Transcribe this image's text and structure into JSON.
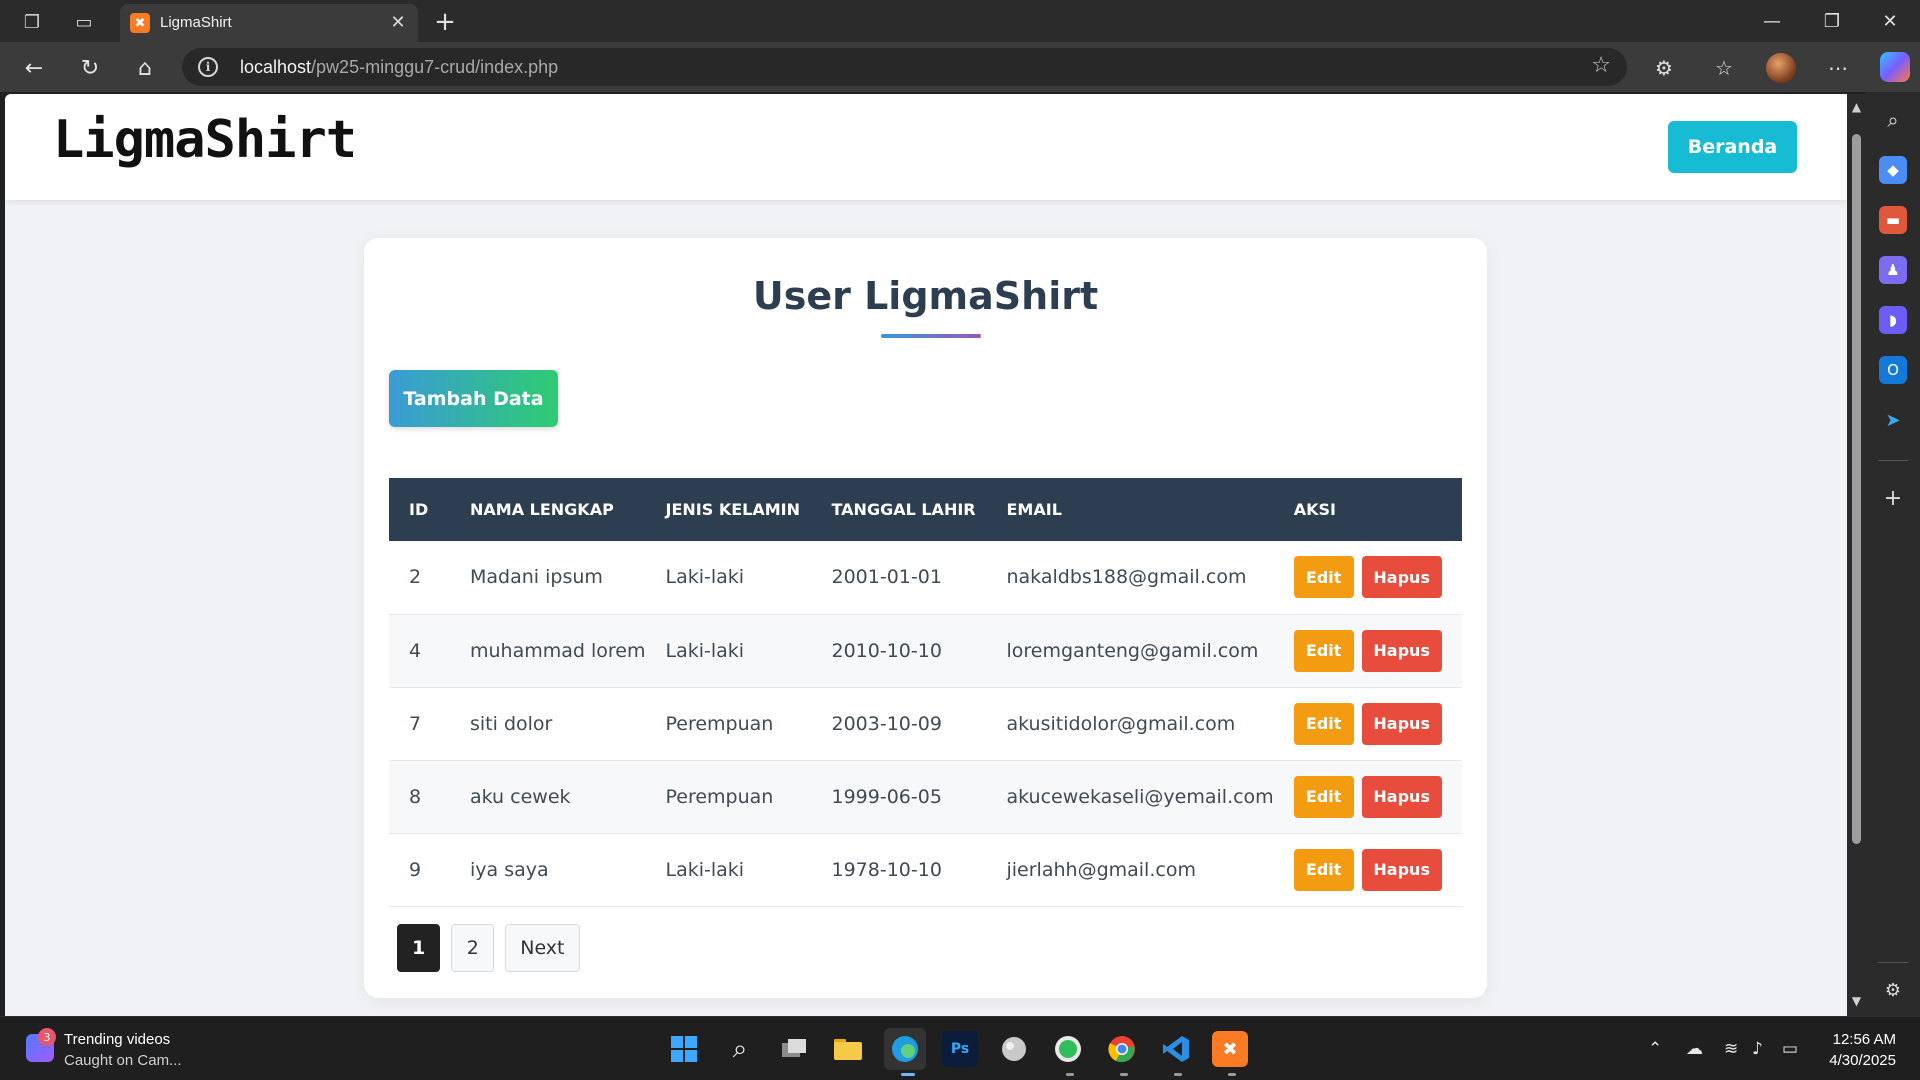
{
  "browser": {
    "tab_title": "LigmaShirt",
    "tab_favicon": "xampp-icon",
    "tab_favicon_glyph": "✖",
    "url_host": "localhost",
    "url_path": "/pw25-minggu7-crud/index.php"
  },
  "site": {
    "logo": "LigmaShirt",
    "nav_button": "Beranda"
  },
  "card": {
    "title": "User LigmaShirt",
    "add_button": "Tambah Data"
  },
  "table": {
    "columns": [
      "ID",
      "NAMA LENGKAP",
      "JENIS KELAMIN",
      "TANGGAL LAHIR",
      "EMAIL",
      "AKSI"
    ],
    "rows": [
      {
        "id": "2",
        "nama": "Madani ipsum",
        "jk": "Laki-laki",
        "tgl": "2001-01-01",
        "email": "nakaldbs188@gmail.com"
      },
      {
        "id": "4",
        "nama": "muhammad lorem",
        "jk": "Laki-laki",
        "tgl": "2010-10-10",
        "email": "loremganteng@gamil.com"
      },
      {
        "id": "7",
        "nama": "siti dolor",
        "jk": "Perempuan",
        "tgl": "2003-10-09",
        "email": "akusitidolor@gmail.com"
      },
      {
        "id": "8",
        "nama": "aku cewek",
        "jk": "Perempuan",
        "tgl": "1999-06-05",
        "email": "akucewekaseli@yemail.com"
      },
      {
        "id": "9",
        "nama": "iya saya",
        "jk": "Laki-laki",
        "tgl": "1978-10-10",
        "email": "jierlahh@gmail.com"
      }
    ],
    "edit_label": "Edit",
    "delete_label": "Hapus"
  },
  "pagination": {
    "pages": [
      "1",
      "2"
    ],
    "active": "1",
    "next_label": "Next"
  },
  "taskbar": {
    "widget_badge": "3",
    "widget_title": "Trending videos",
    "widget_subtitle": "Caught on Cam...",
    "photoshop_label": "Ps",
    "time": "12:56 AM",
    "date": "4/30/2025"
  },
  "colors": {
    "header_dark": "#2c3e50",
    "nav_button": "#17bcd4",
    "edit": "#f39c12",
    "delete": "#e74c3c"
  }
}
